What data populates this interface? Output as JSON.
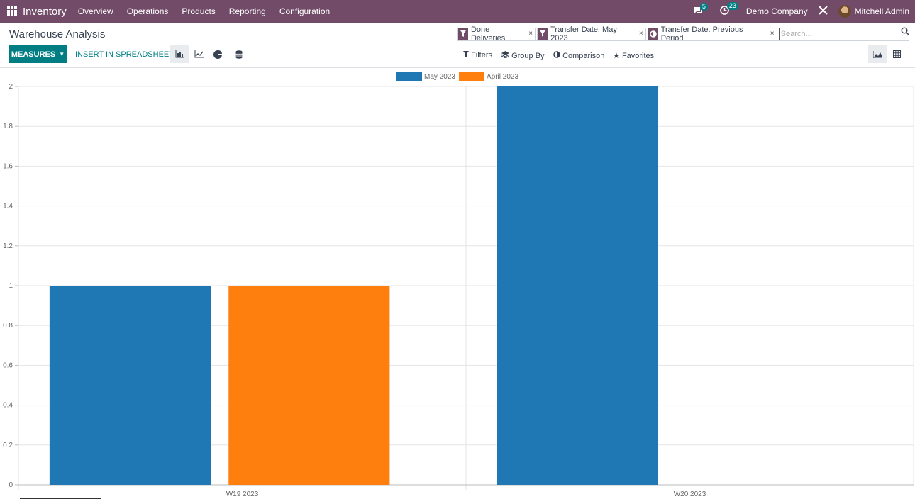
{
  "navbar": {
    "app_name": "Inventory",
    "menu": [
      "Overview",
      "Operations",
      "Products",
      "Reporting",
      "Configuration"
    ],
    "messages_count": "5",
    "activities_count": "23",
    "company": "Demo Company",
    "user": "Mitchell Admin"
  },
  "control": {
    "title": "Warehouse Analysis",
    "measures_label": "MEASURES",
    "insert_label": "INSERT IN SPREADSHEET",
    "facets": [
      {
        "icon": "filter-icon",
        "label": "Done Deliveries"
      },
      {
        "icon": "filter-icon",
        "label": "Transfer Date: May 2023"
      },
      {
        "icon": "comparison-icon",
        "label": "Transfer Date: Previous Period"
      }
    ],
    "search_placeholder": "Search...",
    "filters_label": "Filters",
    "groupby_label": "Group By",
    "comparison_label": "Comparison",
    "favorites_label": "Favorites"
  },
  "colors": {
    "brand": "#714B67",
    "accent": "#017E84",
    "series_1": "#1f77b4",
    "series_2": "#ff7f0e"
  },
  "chart_data": {
    "type": "bar",
    "categories": [
      "W19 2023",
      "W20 2023"
    ],
    "series": [
      {
        "name": "May 2023",
        "values": [
          1,
          2
        ],
        "color": "#1f77b4"
      },
      {
        "name": "April 2023",
        "values": [
          1,
          0
        ],
        "color": "#ff7f0e"
      }
    ],
    "ylim": [
      0,
      2
    ],
    "yticks": [
      0,
      0.2,
      0.4,
      0.6,
      0.8,
      1,
      1.2,
      1.4,
      1.6,
      1.8,
      2
    ],
    "legend_position": "top-center",
    "grid": true
  }
}
